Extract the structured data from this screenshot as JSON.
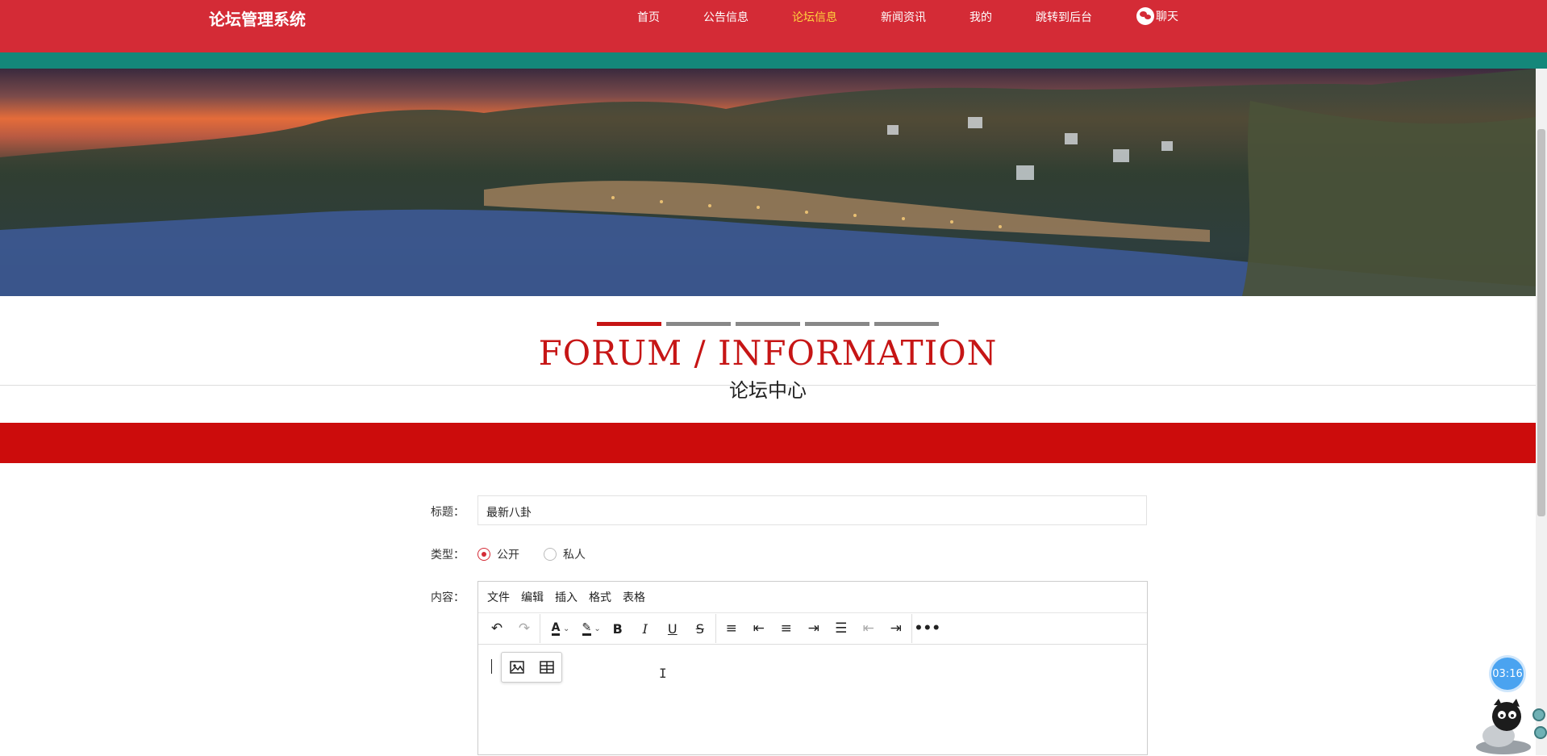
{
  "header": {
    "brand": "论坛管理系统",
    "nav": [
      {
        "label": "首页"
      },
      {
        "label": "公告信息"
      },
      {
        "label": "论坛信息",
        "active": true
      },
      {
        "label": "新闻资讯"
      },
      {
        "label": "我的"
      },
      {
        "label": "跳转到后台"
      }
    ],
    "chat_label": "聊天",
    "bg_color": "#d42b36",
    "active_color": "#ffd33d"
  },
  "section": {
    "title_en": "FORUM / INFORMATION",
    "title_cn": "论坛中心",
    "accent_color": "#c61515"
  },
  "form": {
    "title_label": "标题：",
    "title_value": "最新八卦",
    "type_label": "类型：",
    "type_options": [
      {
        "label": "公开",
        "checked": true
      },
      {
        "label": "私人",
        "checked": false
      }
    ],
    "content_label": "内容："
  },
  "editor": {
    "menus": [
      "文件",
      "编辑",
      "插入",
      "格式",
      "表格"
    ],
    "toolbar_icons": [
      "undo-icon",
      "redo-icon",
      "text-color-icon",
      "highlight-icon",
      "bold-icon",
      "italic-icon",
      "underline-icon",
      "strikethrough-icon",
      "line-height-icon",
      "align-left-icon",
      "align-center-icon",
      "align-right-icon",
      "align-justify-icon",
      "outdent-icon",
      "indent-icon",
      "more-icon"
    ],
    "quick_insert_icons": [
      "image-icon",
      "table-icon"
    ]
  },
  "timer": "03:16"
}
